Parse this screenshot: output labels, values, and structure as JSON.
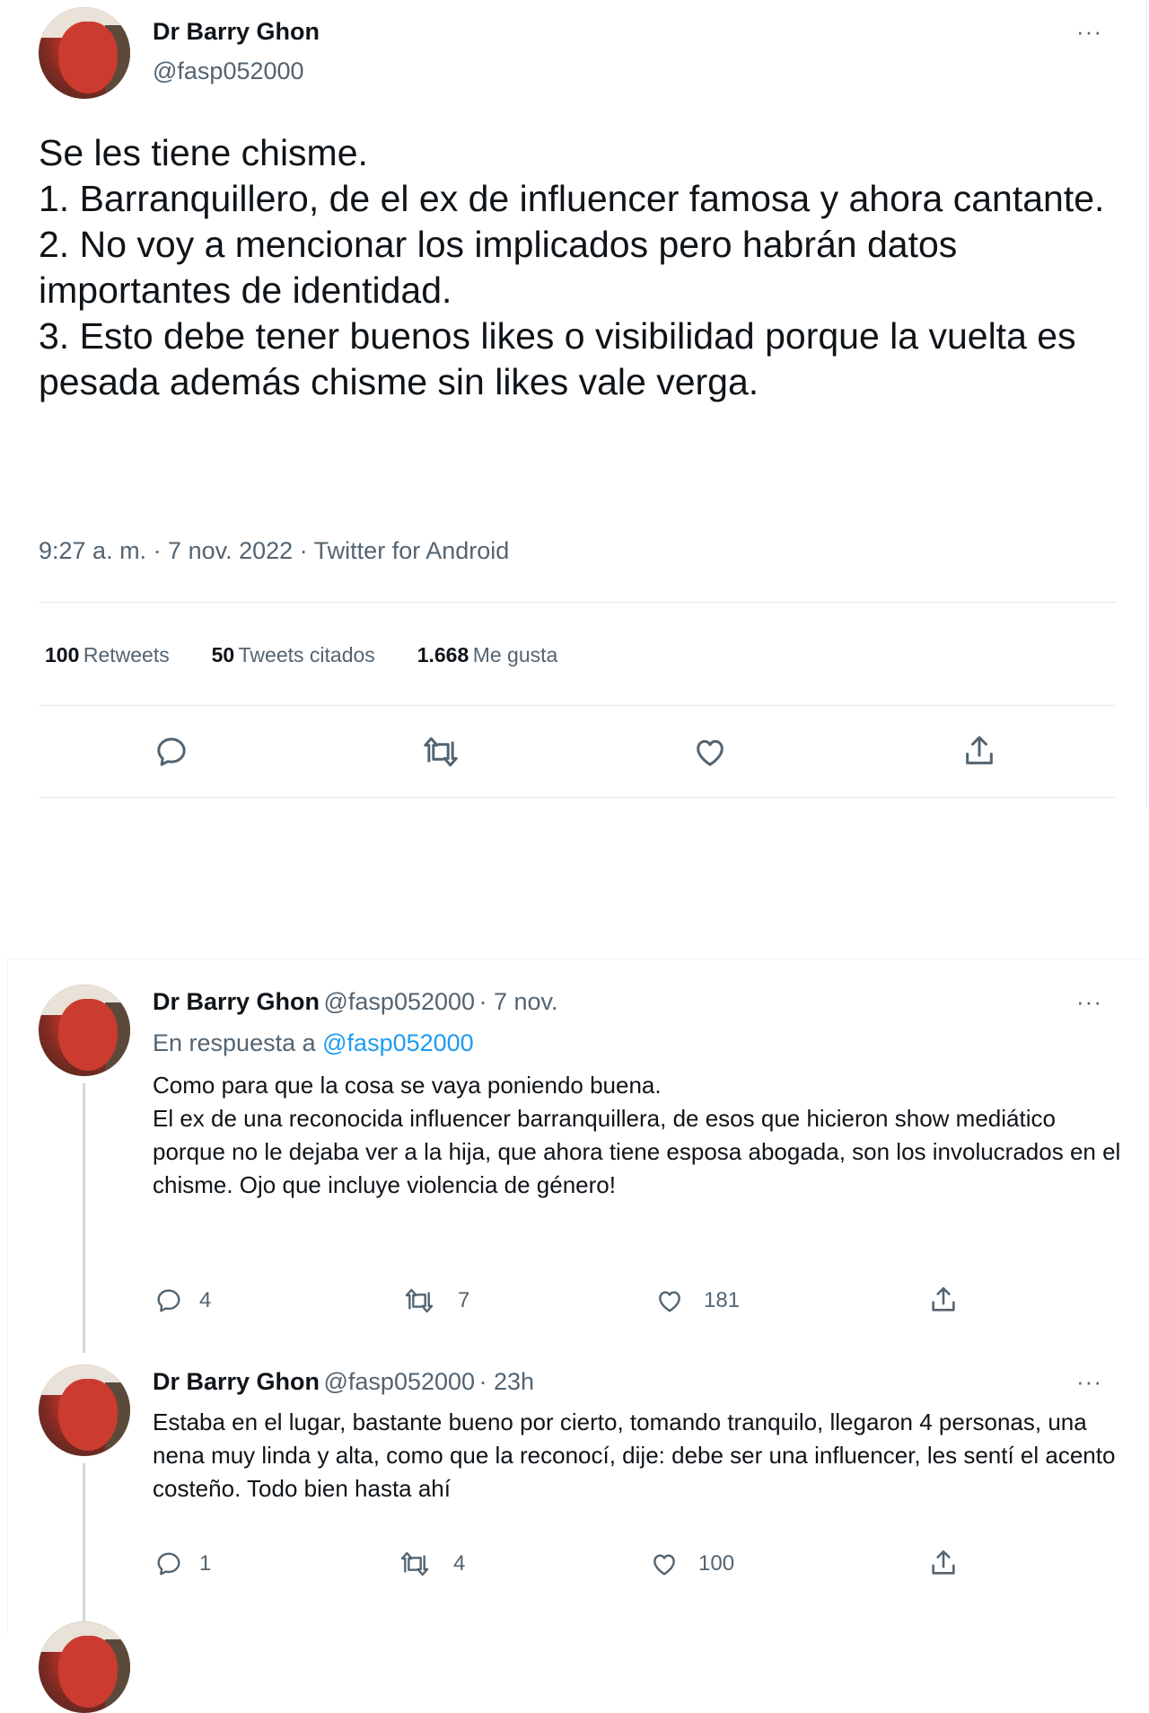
{
  "main_tweet": {
    "author_name": "Dr Barry Ghon",
    "author_handle": "@fasp052000",
    "text": "Se les tiene chisme.\n1. Barranquillero, de el ex de influencer famosa y ahora cantante.\n2. No voy a mencionar los implicados pero habrán datos importantes de identidad.\n3. Esto debe tener buenos likes o visibilidad porque la vuelta es pesada además chisme sin likes vale verga.",
    "meta": "9:27 a. m. · 7 nov. 2022 · Twitter for Android",
    "stats": {
      "retweets_count": "100",
      "retweets_label": "Retweets",
      "quotes_count": "50",
      "quotes_label": "Tweets citados",
      "likes_count": "1.668",
      "likes_label": "Me gusta"
    },
    "more": "···"
  },
  "replies": [
    {
      "author_name": "Dr Barry Ghon",
      "author_handle": "@fasp052000",
      "time": "· 7 nov.",
      "replying_prefix": "En respuesta a",
      "replying_handle": "@fasp052000",
      "text": "Como para que la cosa se vaya poniendo buena.\nEl ex de una reconocida influencer barranquillera, de esos que hicieron show mediático porque no le dejaba ver a la hija, que ahora tiene esposa abogada, son los involucrados en el chisme. Ojo que incluye violencia de género!",
      "reply_count": "4",
      "retweet_count": "7",
      "like_count": "181",
      "more": "···"
    },
    {
      "author_name": "Dr Barry Ghon",
      "author_handle": "@fasp052000",
      "time": "· 23h",
      "text": "Estaba en el lugar, bastante bueno por cierto, tomando tranquilo, llegaron 4 personas, una nena muy linda y alta, como que la reconocí, dije: debe ser una influencer, les sentí el acento costeño. Todo bien hasta ahí",
      "reply_count": "1",
      "retweet_count": "4",
      "like_count": "100",
      "more": "···"
    }
  ],
  "icons": {
    "reply": "reply-icon",
    "retweet": "retweet-icon",
    "like": "heart-icon",
    "share": "share-icon",
    "more": "more-icon"
  },
  "colors": {
    "text": "#0f1419",
    "secondary": "#536471",
    "link": "#1d9bf0",
    "divider": "#e7e9ea"
  }
}
